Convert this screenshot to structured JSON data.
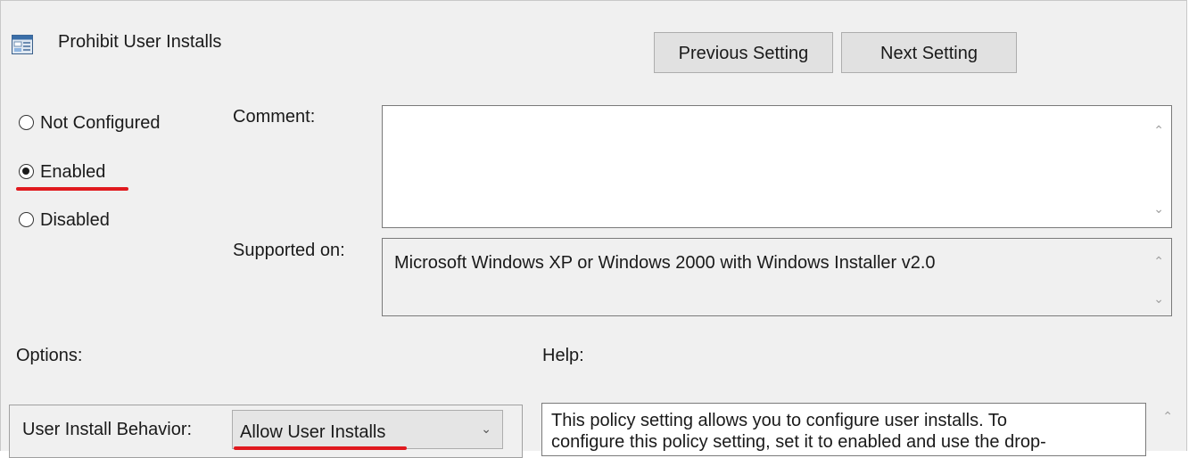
{
  "title": "Prohibit User Installs",
  "buttons": {
    "previous": "Previous Setting",
    "next": "Next Setting"
  },
  "radios": [
    {
      "label": "Not Configured",
      "selected": false
    },
    {
      "label": "Enabled",
      "selected": true
    },
    {
      "label": "Disabled",
      "selected": false
    }
  ],
  "labels": {
    "comment": "Comment:",
    "supported_on": "Supported on:",
    "options": "Options:",
    "help": "Help:"
  },
  "comment": {
    "value": ""
  },
  "supported_on": {
    "value": "Microsoft Windows XP or Windows 2000 with Windows Installer v2.0"
  },
  "options": {
    "user_install_behavior_label": "User Install Behavior:",
    "user_install_behavior_value": "Allow User Installs"
  },
  "help": {
    "line1": "This policy setting allows you to configure user installs. To",
    "line2": "configure this policy setting, set it to enabled and use the drop-"
  },
  "colors": {
    "annotation_underline": "#e0191e",
    "dialog_background": "#f0f0f0"
  },
  "icons": {
    "title": "policy-setting-icon",
    "scroll_up": "chevron-up-icon",
    "scroll_down": "chevron-down-icon",
    "dropdown": "chevron-down-icon"
  }
}
